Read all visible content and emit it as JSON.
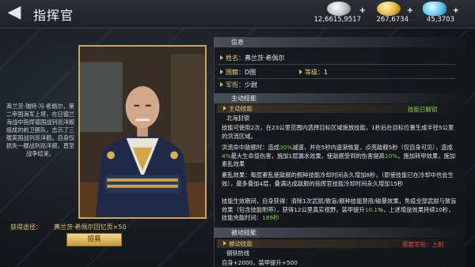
{
  "header": {
    "back_glyph": "◀",
    "title": "指挥官"
  },
  "resources": {
    "silver": {
      "icon": "silver-coins-icon",
      "value": "12,6615,9517"
    },
    "gold": {
      "icon": "gold-coins-icon",
      "value": "267,6734"
    },
    "gems": {
      "icon": "diamond-icon",
      "value": "45,3703"
    },
    "plus": "+"
  },
  "bio": "弗兰茨·瑞特·冯·希佩尔，第二帝国海军上将，在日德兰海战中指挥德国战列巡洋舰组成的前卫舰队，击沉了三艘英国战列巡洋舰。自身仅损失一艘战列巡洋舰，直至战争结束。",
  "acquire": {
    "label": "获得途径：",
    "value": "弗兰茨·希佩尔回忆页×50"
  },
  "recruit_button": "招募",
  "info": {
    "section_title": "信息",
    "name_key": "姓名：",
    "name_val": "弗兰茨·希佩尔",
    "nation_key": "国籍：",
    "nation_val": "D国",
    "level_key": "等级：",
    "level_val": "1",
    "rank_key": "军衔：",
    "rank_val": "少尉"
  },
  "active": {
    "section_title": "主动技能",
    "sub_title": "主动技能",
    "status": "技能已解锁",
    "skill_name": "北海封锁",
    "p1": "技能可使用2次，在23公里范围内选择目标区域施放技能，1秒后在目标位置生成半径5公里的洪流区域。",
    "p2a": "洪流命中敌舰时：造成",
    "p2b": "30%",
    "p2c": "减速，并在5秒内逐渐恢复，点亮敌舰5秒（仅自身可见），造成",
    "p2d": "4%",
    "p2e": "最大生命值伤害，施加1层漏水效果，使敌舰受到的伤害提高",
    "p2f": "10%",
    "p2g": "，施加转甲效果，施加素乱效果",
    "p3": "紊乱效果：每层紊乱使敌舰的舰种技能冷却时间永久增加8秒，（即使技能已在冷却中也会生效），最多叠加4层，叠满达成敌舰的指挥官技能冷却时间永久增加15秒",
    "p4a": "技能生效期间，自身获得：清除1次武损/致盲/舰种技能禁用/磁暴效果，免疫全部武损与致盲效果（包含技能附带），获得12公里真实视野，装甲提升",
    "p4b": "10.1",
    "p4c": "%，上述增益效果持续10秒，技能充能时间：",
    "p4d": "189秒"
  },
  "passive": {
    "section_title": "被动技能",
    "sub_title": "被动技能",
    "requirement": "需要军衔：上尉",
    "skill_name": "钢铁防线",
    "p1": "自身+2000，装甲提升+500"
  },
  "colors": {
    "accent_gold": "#e8c77b",
    "highlight_green": "#7fd34e",
    "warning_red": "#e0463e"
  }
}
